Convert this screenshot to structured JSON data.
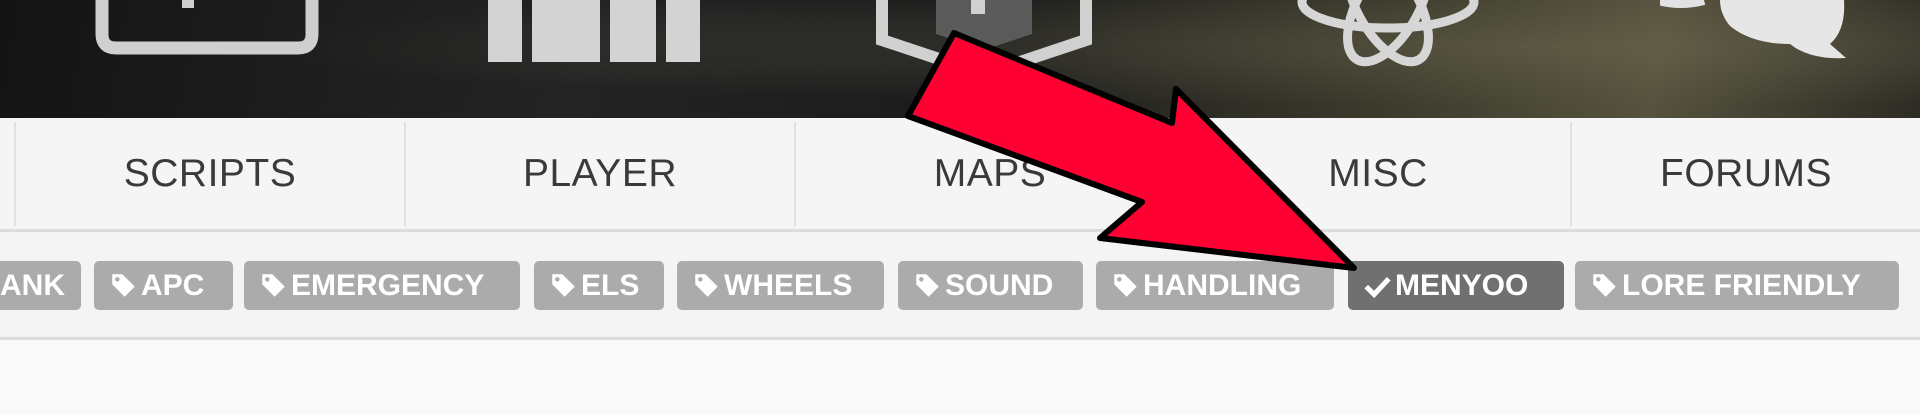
{
  "nav": {
    "items": [
      {
        "label": ""
      },
      {
        "label": "SCRIPTS"
      },
      {
        "label": "PLAYER"
      },
      {
        "label": "MAPS"
      },
      {
        "label": "MISC"
      },
      {
        "label": "FORUMS"
      }
    ]
  },
  "tags": {
    "items": [
      {
        "label": "ANK",
        "icon": "tag-icon"
      },
      {
        "label": "APC",
        "icon": "tag-icon"
      },
      {
        "label": "EMERGENCY",
        "icon": "tag-icon"
      },
      {
        "label": "ELS",
        "icon": "tag-icon"
      },
      {
        "label": "WHEELS",
        "icon": "tag-icon"
      },
      {
        "label": "SOUND",
        "icon": "tag-icon"
      },
      {
        "label": "HANDLING",
        "icon": "tag-icon"
      },
      {
        "label": "MENYOO",
        "icon": "check-icon",
        "active": true
      },
      {
        "label": "LORE FRIENDLY",
        "icon": "tag-icon"
      }
    ]
  },
  "colors": {
    "tag_bg": "#ababab",
    "tag_active_bg": "#707070",
    "arrow": "#ff0033",
    "nav_text": "#3a3a3a"
  }
}
